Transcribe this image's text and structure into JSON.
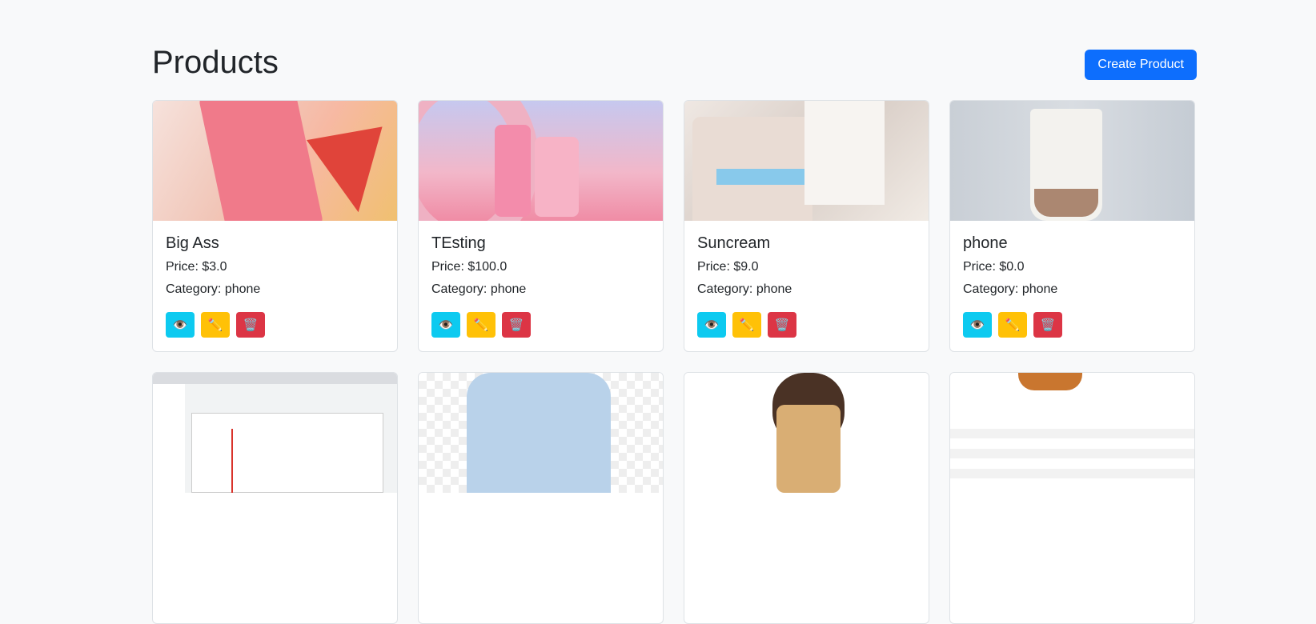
{
  "page": {
    "title": "Products"
  },
  "toolbar": {
    "create_label": "Create Product"
  },
  "colors": {
    "primary": "#0d6efd",
    "info": "#0dcaf0",
    "warning": "#ffc107",
    "danger": "#dc3545"
  },
  "icons": {
    "view": "eye-icon",
    "edit": "pencil-icon",
    "delete": "trash-icon"
  },
  "products": [
    {
      "name": "Big Ass",
      "price": "Price: $3.0",
      "category": "Category: phone"
    },
    {
      "name": "TEsting",
      "price": "Price: $100.0",
      "category": "Category: phone"
    },
    {
      "name": "Suncream",
      "price": "Price: $9.0",
      "category": "Category: phone"
    },
    {
      "name": "phone",
      "price": "Price: $0.0",
      "category": "Category: phone"
    }
  ]
}
